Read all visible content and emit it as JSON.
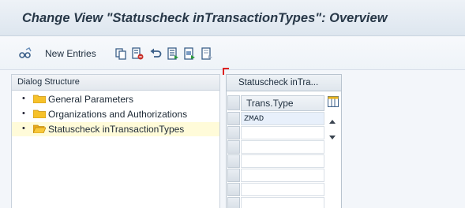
{
  "title": "Change View \"Statuscheck inTransactionTypes\": Overview",
  "toolbar": {
    "new_entries_label": "New Entries"
  },
  "dialog_structure": {
    "header": "Dialog Structure",
    "items": [
      {
        "bullet": "•",
        "label": "General Parameters"
      },
      {
        "bullet": "•",
        "label": "Organizations and Authorizations"
      },
      {
        "bullet": "•",
        "label": "Statuscheck inTransactionTypes"
      }
    ]
  },
  "table": {
    "title": "Statuscheck inTra...",
    "column_header": "Trans.Type",
    "rows": [
      "ZMAD"
    ]
  },
  "colors": {
    "title_text": "#283848",
    "selected_row": "#fffbd9",
    "folder_yellow": "#f6c12a",
    "first_cell": "#e8f0fb"
  }
}
